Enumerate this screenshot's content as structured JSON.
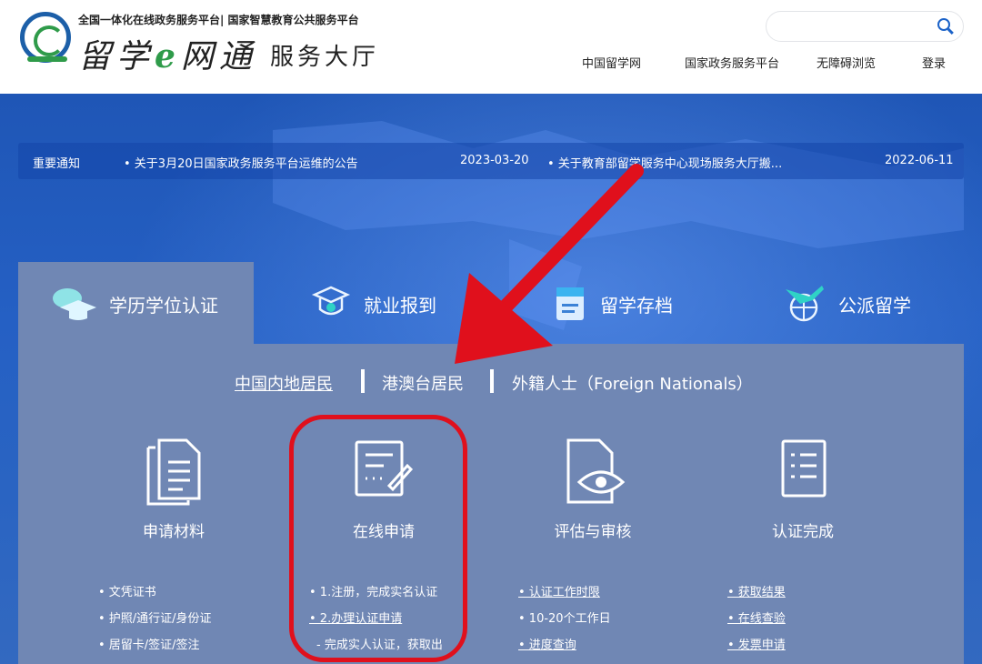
{
  "header": {
    "tagline": "全国一体化在线政务服务平台| 国家智慧教育公共服务平台",
    "brand_part1": "留学",
    "brand_e": "e",
    "brand_part2": "网通",
    "brand_sub": "服务大厅",
    "search_placeholder": "",
    "nav": [
      "中国留学网",
      "国家政务服务平台",
      "无障碍浏览",
      "登录"
    ]
  },
  "notice": {
    "label": "重要通知",
    "items": [
      {
        "title": "• 关于3月20日国家政务服务平台运维的公告",
        "date": "2023-03-20"
      },
      {
        "title": "• 关于教育部留学服务中心现场服务大厅搬...",
        "date": "2022-06-11"
      }
    ]
  },
  "tabs": [
    {
      "label": "学历学位认证",
      "icon": "graduation-cap-icon",
      "active": true
    },
    {
      "label": "就业报到",
      "icon": "cap-badge-icon",
      "active": false
    },
    {
      "label": "留学存档",
      "icon": "archive-folder-icon",
      "active": false
    },
    {
      "label": "公派留学",
      "icon": "plane-globe-icon",
      "active": false
    }
  ],
  "subtabs": [
    "中国内地居民",
    "港澳台居民",
    "外籍人士（Foreign Nationals）"
  ],
  "steps": [
    {
      "title": "申请材料",
      "icon": "documents-icon",
      "items": [
        "• 文凭证书",
        "• 护照/通行证/身份证",
        "• 居留卡/签证/签注"
      ]
    },
    {
      "title": "在线申请",
      "icon": "form-edit-icon",
      "items": [
        "• 1.注册，完成实名认证",
        "• 2.办理认证申请",
        "- 完成实人认证，获取出"
      ]
    },
    {
      "title": "评估与审核",
      "icon": "document-eye-icon",
      "items": [
        "• 认证工作时限",
        "• 10-20个工作日",
        "• 进度查询"
      ]
    },
    {
      "title": "认证完成",
      "icon": "checklist-icon",
      "items": [
        "• 获取结果",
        "• 在线查验",
        "• 发票申请"
      ]
    }
  ],
  "colors": {
    "accent_blue": "#1b62c8",
    "annotation_red": "#e0101c",
    "panel": "#7087b4"
  }
}
